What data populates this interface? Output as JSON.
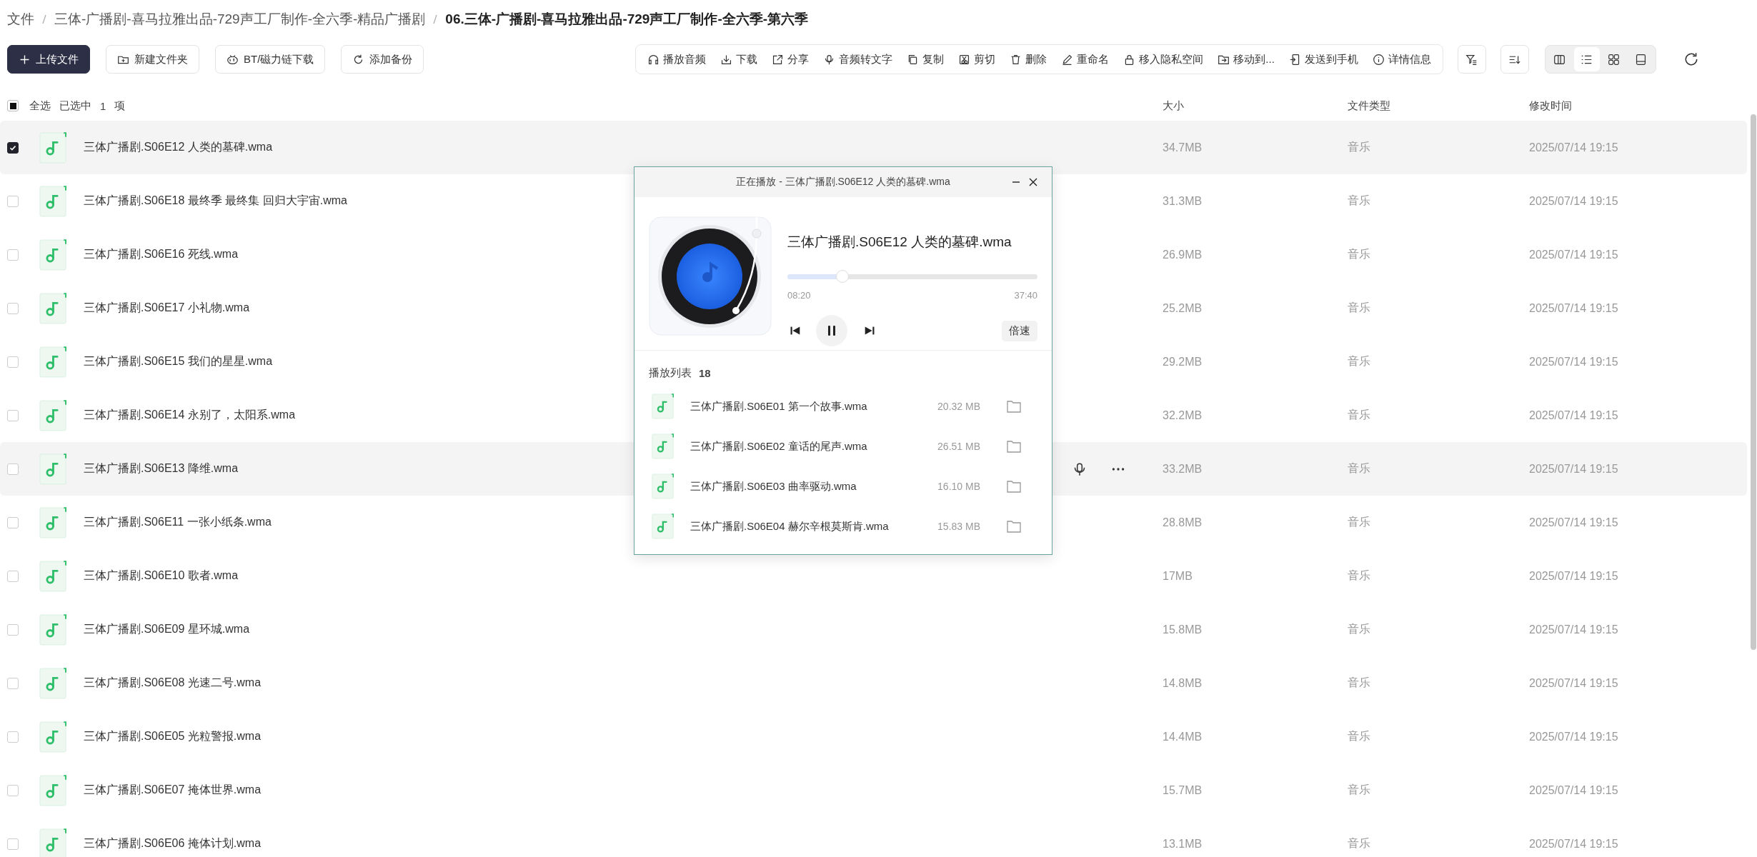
{
  "breadcrumb": [
    "文件",
    "三体-广播剧-喜马拉雅出品-729声工厂制作-全六季-精品广播剧",
    "06.三体-广播剧-喜马拉雅出品-729声工厂制作-全六季-第六季"
  ],
  "left_buttons": [
    {
      "kind": "upload",
      "label": "上传文件"
    },
    {
      "kind": "folder",
      "label": "新建文件夹"
    },
    {
      "kind": "bt",
      "label": "BT/磁力链下载"
    },
    {
      "kind": "backup",
      "label": "添加备份"
    }
  ],
  "actions": [
    {
      "kind": "headphones",
      "label": "播放音频"
    },
    {
      "kind": "download",
      "label": "下载"
    },
    {
      "kind": "share",
      "label": "分享"
    },
    {
      "kind": "mic",
      "label": "音频转文字"
    },
    {
      "kind": "copy",
      "label": "复制"
    },
    {
      "kind": "cut",
      "label": "剪切"
    },
    {
      "kind": "trash",
      "label": "删除"
    },
    {
      "kind": "pen",
      "label": "重命名"
    },
    {
      "kind": "lock",
      "label": "移入隐私空间"
    },
    {
      "kind": "move",
      "label": "移动到..."
    },
    {
      "kind": "phone",
      "label": "发送到手机"
    },
    {
      "kind": "info",
      "label": "详情信息"
    }
  ],
  "views": [
    {
      "kind": "columns",
      "selected": false
    },
    {
      "kind": "list",
      "selected": true
    },
    {
      "kind": "grid",
      "selected": false
    },
    {
      "kind": "preview",
      "selected": false
    }
  ],
  "selection": {
    "indeterminate": true,
    "select_all": "全选",
    "selected_label": "已选中",
    "count": "1",
    "unit": "项"
  },
  "columns": [
    "大小",
    "文件类型",
    "修改时间"
  ],
  "rows": [
    {
      "name": "三体广播剧.S06E12 人类的墓碑.wma",
      "size": "34.7MB",
      "type": "音乐",
      "time": "2025/07/14 19:15",
      "checked": true,
      "hovered": false
    },
    {
      "name": "三体广播剧.S06E18 最终季 最终集 回归大宇宙.wma",
      "size": "31.3MB",
      "type": "音乐",
      "time": "2025/07/14 19:15",
      "checked": false,
      "hovered": false
    },
    {
      "name": "三体广播剧.S06E16 死线.wma",
      "size": "26.9MB",
      "type": "音乐",
      "time": "2025/07/14 19:15",
      "checked": false,
      "hovered": false
    },
    {
      "name": "三体广播剧.S06E17 小礼物.wma",
      "size": "25.2MB",
      "type": "音乐",
      "time": "2025/07/14 19:15",
      "checked": false,
      "hovered": false
    },
    {
      "name": "三体广播剧.S06E15 我们的星星.wma",
      "size": "29.2MB",
      "type": "音乐",
      "time": "2025/07/14 19:15",
      "checked": false,
      "hovered": false
    },
    {
      "name": "三体广播剧.S06E14 永别了，太阳系.wma",
      "size": "32.2MB",
      "type": "音乐",
      "time": "2025/07/14 19:15",
      "checked": false,
      "hovered": false
    },
    {
      "name": "三体广播剧.S06E13 降维.wma",
      "size": "33.2MB",
      "type": "音乐",
      "time": "2025/07/14 19:15",
      "checked": false,
      "hovered": true
    },
    {
      "name": "三体广播剧.S06E11 一张小纸条.wma",
      "size": "28.8MB",
      "type": "音乐",
      "time": "2025/07/14 19:15",
      "checked": false,
      "hovered": false
    },
    {
      "name": "三体广播剧.S06E10 歌者.wma",
      "size": "17MB",
      "type": "音乐",
      "time": "2025/07/14 19:15",
      "checked": false,
      "hovered": false
    },
    {
      "name": "三体广播剧.S06E09 星环城.wma",
      "size": "15.8MB",
      "type": "音乐",
      "time": "2025/07/14 19:15",
      "checked": false,
      "hovered": false
    },
    {
      "name": "三体广播剧.S06E08 光速二号.wma",
      "size": "14.8MB",
      "type": "音乐",
      "time": "2025/07/14 19:15",
      "checked": false,
      "hovered": false
    },
    {
      "name": "三体广播剧.S06E05 光粒警报.wma",
      "size": "14.4MB",
      "type": "音乐",
      "time": "2025/07/14 19:15",
      "checked": false,
      "hovered": false
    },
    {
      "name": "三体广播剧.S06E07 掩体世界.wma",
      "size": "15.7MB",
      "type": "音乐",
      "time": "2025/07/14 19:15",
      "checked": false,
      "hovered": false
    },
    {
      "name": "三体广播剧.S06E06 掩体计划.wma",
      "size": "13.1MB",
      "type": "音乐",
      "time": "2025/07/14 19:15",
      "checked": false,
      "hovered": false
    }
  ],
  "player": {
    "title": "正在播放 - 三体广播剧.S06E12 人类的墓碑.wma",
    "track": "三体广播剧.S06E12 人类的墓碑.wma",
    "level": 0.22,
    "elapsed": "08:20",
    "total": "37:40",
    "speed": "倍速",
    "playlist_label": "播放列表",
    "playlist_count": "18",
    "playlist": [
      {
        "name": "三体广播剧.S06E01 第一个故事.wma",
        "size": "20.32 MB"
      },
      {
        "name": "三体广播剧.S06E02 童话的尾声.wma",
        "size": "26.51 MB"
      },
      {
        "name": "三体广播剧.S06E03 曲率驱动.wma",
        "size": "16.10 MB"
      },
      {
        "name": "三体广播剧.S06E04 赫尔辛根莫斯肯.wma",
        "size": "15.83 MB"
      }
    ]
  }
}
